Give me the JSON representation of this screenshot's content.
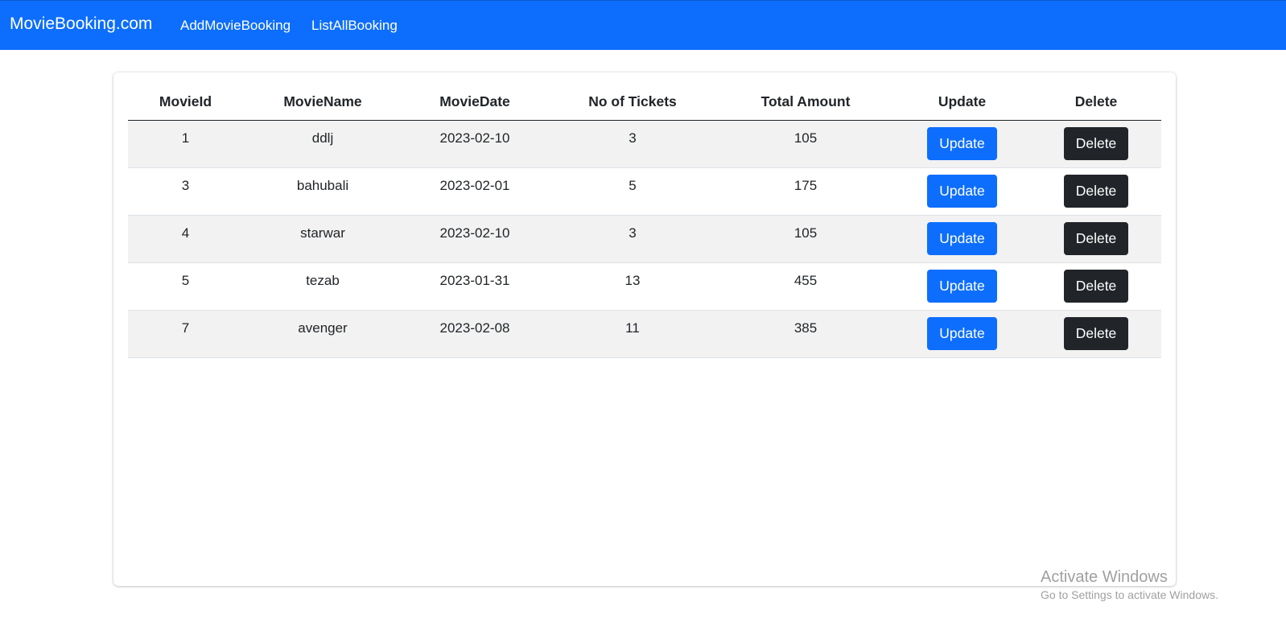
{
  "navbar": {
    "brand": "MovieBooking.com",
    "links": [
      "AddMovieBooking",
      "ListAllBooking"
    ]
  },
  "table": {
    "headers": [
      "MovieId",
      "MovieName",
      "MovieDate",
      "No of Tickets",
      "Total Amount",
      "Update",
      "Delete"
    ],
    "rows": [
      {
        "id": "1",
        "name": "ddlj",
        "date": "2023-02-10",
        "tickets": "3",
        "amount": "105",
        "update": "Update",
        "delete": "Delete"
      },
      {
        "id": "3",
        "name": "bahubali",
        "date": "2023-02-01",
        "tickets": "5",
        "amount": "175",
        "update": "Update",
        "delete": "Delete"
      },
      {
        "id": "4",
        "name": "starwar",
        "date": "2023-02-10",
        "tickets": "3",
        "amount": "105",
        "update": "Update",
        "delete": "Delete"
      },
      {
        "id": "5",
        "name": "tezab",
        "date": "2023-01-31",
        "tickets": "13",
        "amount": "455",
        "update": "Update",
        "delete": "Delete"
      },
      {
        "id": "7",
        "name": "avenger",
        "date": "2023-02-08",
        "tickets": "11",
        "amount": "385",
        "update": "Update",
        "delete": "Delete"
      }
    ]
  },
  "watermark": {
    "title": "Activate Windows",
    "subtitle": "Go to Settings to activate Windows."
  },
  "colors": {
    "navbar": "#0d6efd",
    "update_button": "#0d6efd",
    "delete_button": "#212529",
    "striped_row": "#f2f2f2"
  }
}
